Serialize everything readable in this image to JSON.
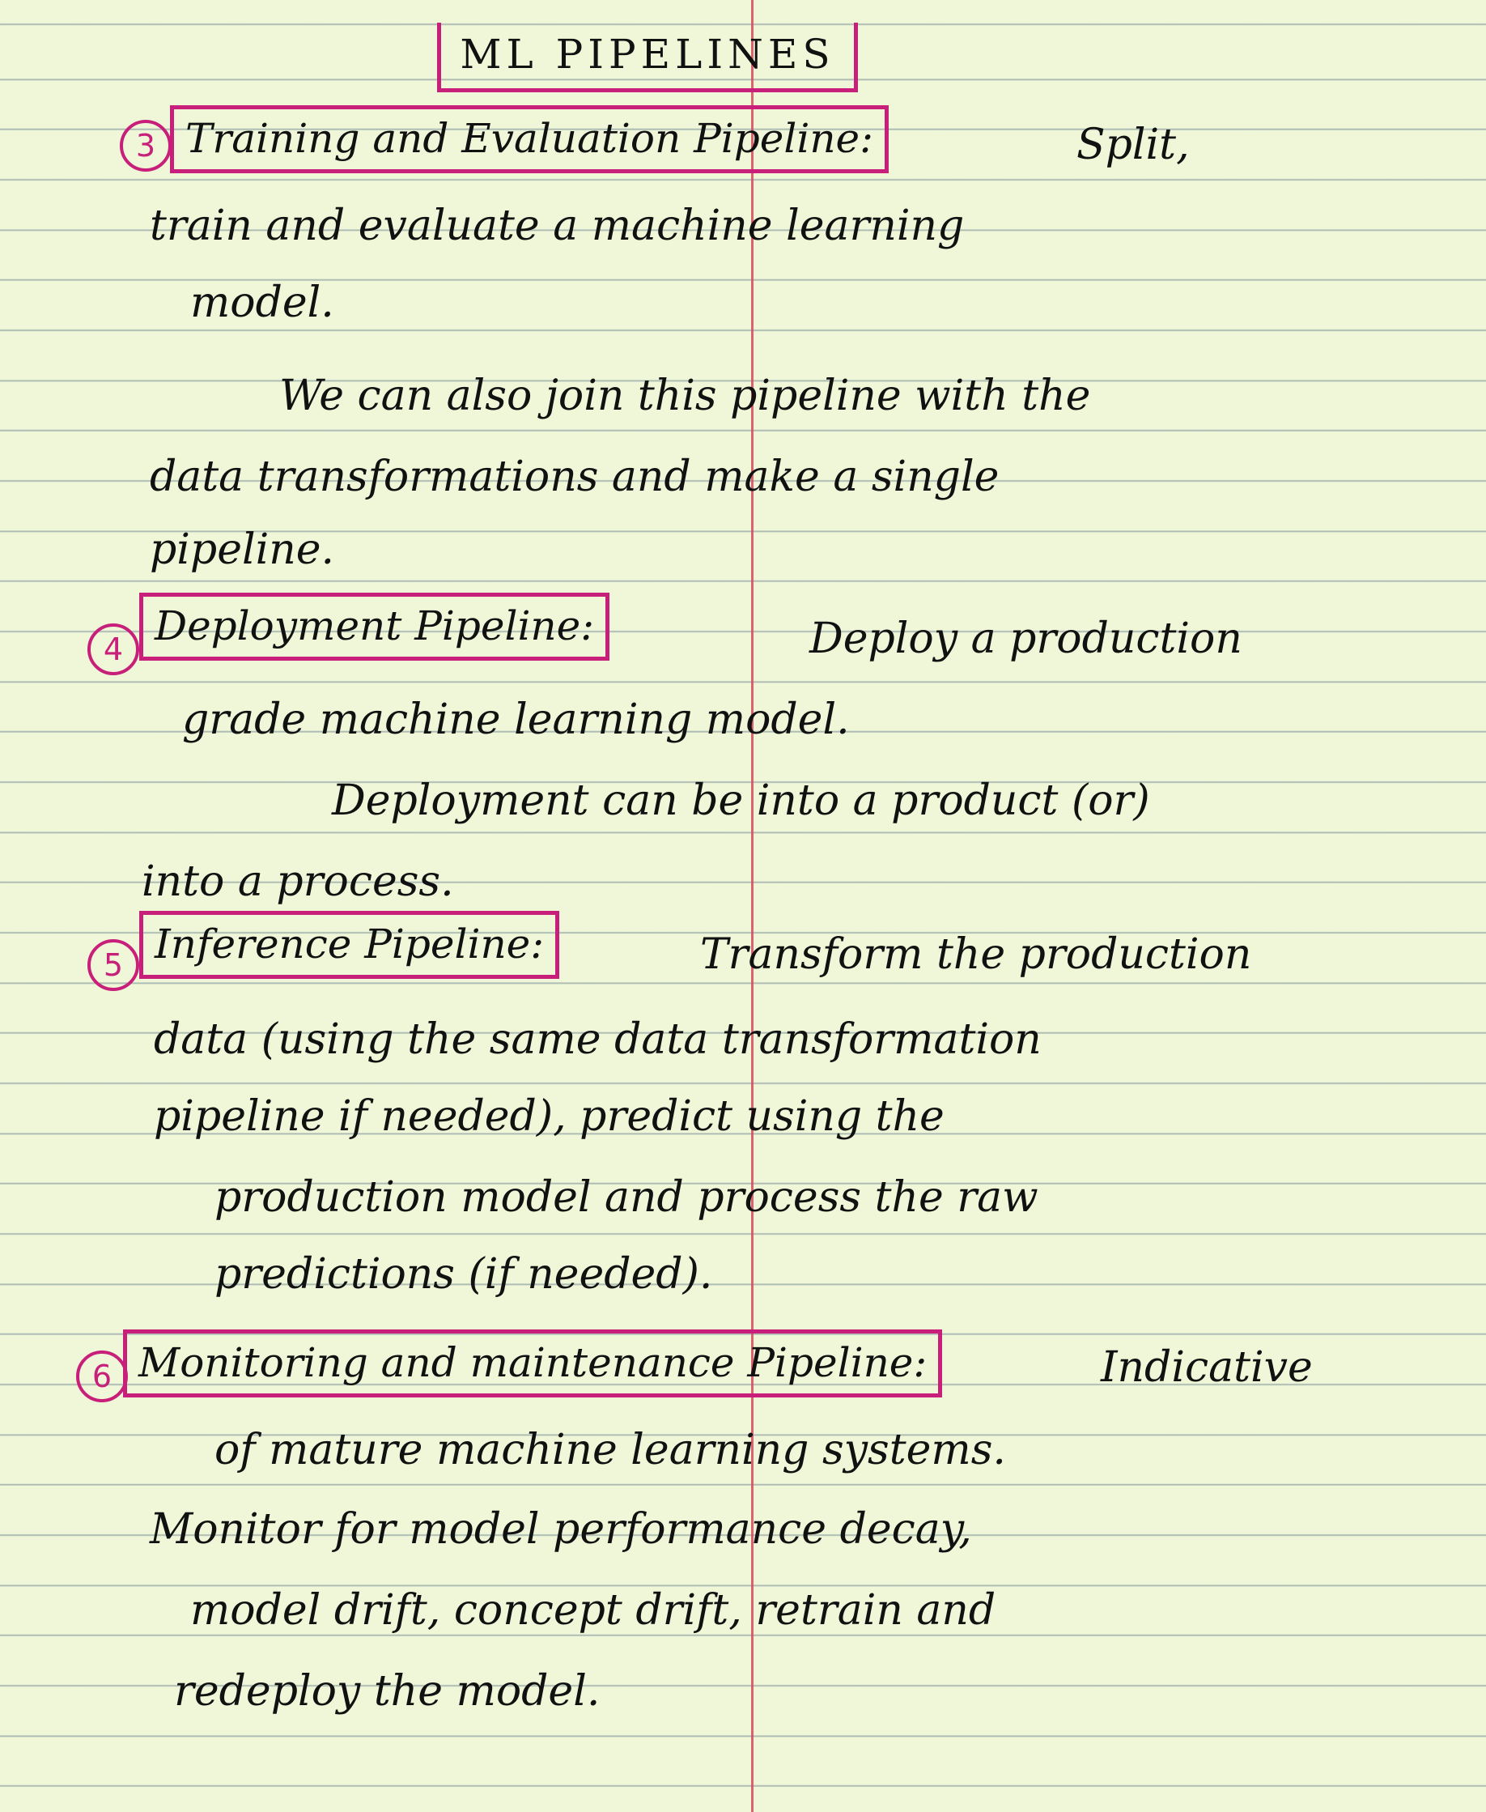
{
  "page": {
    "title": "ML PIPELINES"
  },
  "sections": [
    {
      "number": "3",
      "heading": "Training and Evaluation Pipeline:",
      "lines": [
        "Split,",
        "train and evaluate a machine learning",
        "model.",
        "We can also join this pipeline with the",
        "data transformations and make a single",
        "pipeline."
      ]
    },
    {
      "number": "4",
      "heading": "Deployment Pipeline:",
      "lines": [
        "Deploy a production",
        "grade machine learning model.",
        "Deployment can be into a product (or)",
        "into a process."
      ]
    },
    {
      "number": "5",
      "heading": "Inference Pipeline:",
      "lines": [
        "Transform the production",
        "data (using the same data transformation",
        "pipeline if needed), predict using the",
        "production model and process the raw",
        "predictions (if needed)."
      ]
    },
    {
      "number": "6",
      "heading": "Monitoring and maintenance Pipeline:",
      "lines": [
        "Indicative",
        "of mature machine learning systems.",
        "Monitor for model performance decay,",
        "model drift, concept drift, retrain and",
        "redeploy the model."
      ]
    }
  ]
}
